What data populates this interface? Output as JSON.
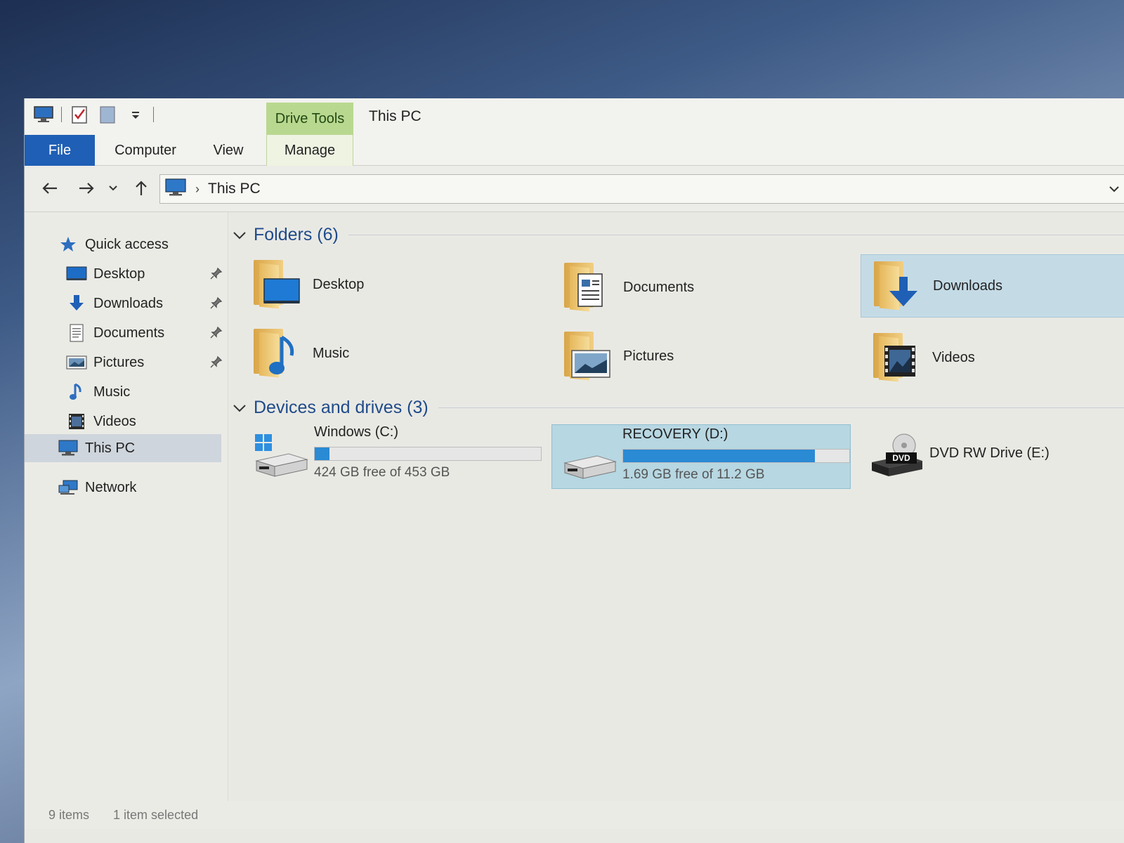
{
  "window": {
    "title": "This PC",
    "context_tab": "Drive Tools"
  },
  "ribbon": {
    "tabs": [
      "File",
      "Computer",
      "View",
      "Manage"
    ]
  },
  "address": {
    "crumb": "This PC"
  },
  "sidebar": {
    "quick_access": "Quick access",
    "items": [
      {
        "label": "Desktop",
        "icon": "desktop-icon",
        "pinned": true
      },
      {
        "label": "Downloads",
        "icon": "downloads-icon",
        "pinned": true
      },
      {
        "label": "Documents",
        "icon": "documents-icon",
        "pinned": true
      },
      {
        "label": "Pictures",
        "icon": "pictures-icon",
        "pinned": true
      },
      {
        "label": "Music",
        "icon": "music-icon",
        "pinned": false
      },
      {
        "label": "Videos",
        "icon": "videos-icon",
        "pinned": false
      }
    ],
    "this_pc": "This PC",
    "network": "Network"
  },
  "main": {
    "folders_header": "Folders (6)",
    "folders": [
      {
        "label": "Desktop",
        "icon": "desktop-folder-icon"
      },
      {
        "label": "Documents",
        "icon": "documents-folder-icon"
      },
      {
        "label": "Downloads",
        "icon": "downloads-folder-icon",
        "selected": true
      },
      {
        "label": "Music",
        "icon": "music-folder-icon"
      },
      {
        "label": "Pictures",
        "icon": "pictures-folder-icon"
      },
      {
        "label": "Videos",
        "icon": "videos-folder-icon"
      }
    ],
    "devices_header": "Devices and drives (3)",
    "drives": [
      {
        "name": "Windows (C:)",
        "free": "424 GB free of 453 GB",
        "used_fraction": 0.064
      },
      {
        "name": "RECOVERY (D:)",
        "free": "1.69 GB free of 11.2 GB",
        "used_fraction": 0.849,
        "selected": true
      },
      {
        "name": "DVD RW Drive (E:)",
        "free": "",
        "icon_text": "DVD"
      }
    ]
  },
  "status": {
    "items": "9 items",
    "selected": "1 item selected"
  },
  "colors": {
    "file_tab": "#1f5fb5",
    "context_tab": "#b9d88f",
    "bar_fill": "#2a8ad4",
    "header_text": "#1f4b8a"
  }
}
